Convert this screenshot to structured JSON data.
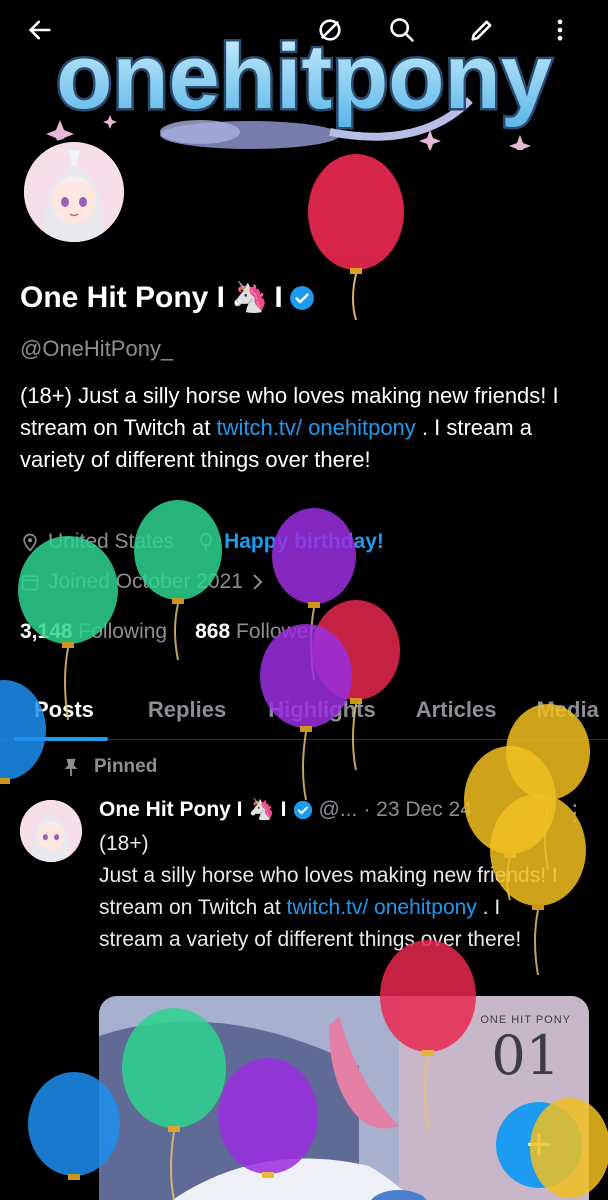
{
  "banner": {
    "logo_text": "onehitpony"
  },
  "topbar": {
    "back_icon": "arrow-left-icon",
    "grok_icon": "slash-circle-icon",
    "search_icon": "search-icon",
    "edit_icon": "pencil-icon",
    "more_icon": "vertical-dots-icon"
  },
  "profile": {
    "name": "One Hit Pony I",
    "name_suffix": "I",
    "emoji": "🦄",
    "handle": "@OneHitPony_",
    "bio_1": "(18+) Just a silly horse who loves making new friends! I stream on Twitch at ",
    "bio_link": "twitch.tv/ onehitpony",
    "bio_2": " . I stream a variety of different things over there!",
    "location": "United States",
    "birthday": "Happy birthday!",
    "joined": "Joined October 2021",
    "following_count": "3,148",
    "following_label": "Following",
    "followers_count": "868",
    "followers_label": "Followers"
  },
  "tabs": [
    {
      "label": "Posts"
    },
    {
      "label": "Replies"
    },
    {
      "label": "Highlights"
    },
    {
      "label": "Articles"
    },
    {
      "label": "Media"
    }
  ],
  "post": {
    "pinned_label": "Pinned",
    "name": "One Hit Pony I",
    "emoji": "🦄",
    "suffix": "I",
    "handle": "@...",
    "date": "· 23 Dec 24",
    "more": "⋮",
    "text_1": "(18+)\nJust a silly horse who loves making new friends! I stream on Twitch at ",
    "text_link": "twitch.tv/ onehitpony",
    "text_2": " . I stream a variety of different things over there!",
    "media_badge_small": "ONE HIT PONY",
    "media_badge_big": "01"
  },
  "fab": {
    "label": "+"
  },
  "colors": {
    "accent": "#1d9bf0",
    "background": "#000000",
    "muted": "#8b8f94"
  }
}
